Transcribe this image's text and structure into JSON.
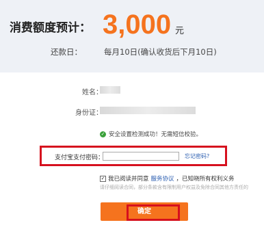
{
  "credit": {
    "label": "消费额度预计：",
    "amount": "3,000",
    "unit": "元"
  },
  "repayment": {
    "label": "还款日：",
    "value": "每月10日(确认收货后下月10日)"
  },
  "fields": {
    "name_label": "姓名：",
    "id_label": "身份证："
  },
  "security": {
    "message": "安全设置检测成功！无需短信校验。",
    "icon": "check-circle-icon",
    "icon_color": "#3aa13a"
  },
  "payment": {
    "password_label": "支付宝支付密码：",
    "password_value": "",
    "forgot_link": "忘记密码?"
  },
  "agreement": {
    "checked": true,
    "prefix": "我已阅读并同意",
    "link": "服务协议",
    "suffix": "，已知晓所有权利义务",
    "note": "请仔细阅读合同，部分条款含有限制用户权益及免除合同其他方责任的"
  },
  "confirm": {
    "label": "确定",
    "color": "#f5731e"
  },
  "highlight_color": "#d6101e",
  "amount_color": "#f5731e"
}
